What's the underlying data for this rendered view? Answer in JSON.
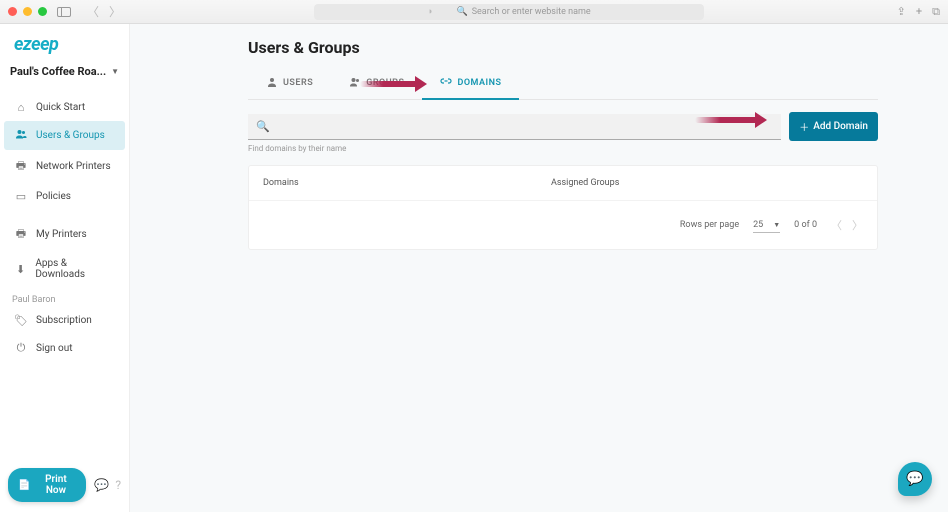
{
  "browser": {
    "address_placeholder": "Search or enter website name"
  },
  "sidebar": {
    "logo": "ezeep",
    "org_name": "Paul's Coffee Roa...",
    "items": [
      {
        "label": "Quick Start",
        "icon": "⌂"
      },
      {
        "label": "Users & Groups",
        "icon": "👥",
        "active": true
      },
      {
        "label": "Network Printers",
        "icon": "🖶"
      },
      {
        "label": "Policies",
        "icon": "⬛"
      }
    ],
    "items2": [
      {
        "label": "My Printers",
        "icon": "🖶"
      },
      {
        "label": "Apps & Downloads",
        "icon": "⬇"
      }
    ],
    "user_label": "Paul Baron",
    "user_items": [
      {
        "label": "Subscription",
        "icon": "🏷"
      },
      {
        "label": "Sign out",
        "icon": "⏻"
      }
    ],
    "print_now": "Print Now"
  },
  "page": {
    "title": "Users & Groups",
    "tabs": [
      {
        "label": "USERS",
        "key": "users"
      },
      {
        "label": "GROUPS",
        "key": "groups"
      },
      {
        "label": "DOMAINS",
        "key": "domains",
        "active": true
      }
    ],
    "search_help": "Find domains by their name",
    "add_button": "Add Domain",
    "table": {
      "col1": "Domains",
      "col2": "Assigned Groups",
      "rows_per_page_label": "Rows per page",
      "rows_per_page_value": "25",
      "range": "0 of 0"
    }
  }
}
